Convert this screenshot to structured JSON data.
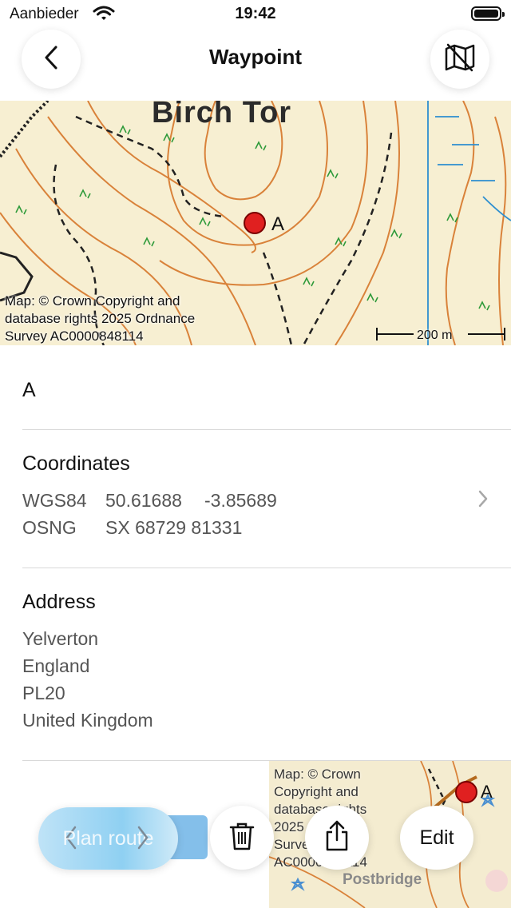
{
  "status_bar": {
    "carrier": "Aanbieder",
    "time": "19:42"
  },
  "nav": {
    "title": "Waypoint",
    "back_icon": "chevron-left-icon",
    "map_toggle_icon": "map-off-icon"
  },
  "map": {
    "place_label": "Birch Tor",
    "marker_label": "A",
    "credit": [
      "Map: © Crown Copyright and",
      "database rights 2025 Ordnance",
      "Survey AC0000848114"
    ],
    "scale": "200 m",
    "marker_color": "#e02020"
  },
  "waypoint": {
    "name": "A"
  },
  "coordinates": {
    "title": "Coordinates",
    "rows": [
      {
        "system": "WGS84",
        "value1": "50.61688",
        "value2": "-3.85689"
      },
      {
        "system": "OSNG",
        "value1": "SX 68729 81331",
        "value2": ""
      }
    ]
  },
  "address": {
    "title": "Address",
    "lines": [
      "Yelverton",
      "England",
      "PL20",
      "United Kingdom"
    ]
  },
  "mini_map": {
    "credit": [
      "Map: © Crown",
      "Copyright and",
      "database rights",
      "2025 Ordnance",
      "Survey",
      "AC0000848114"
    ],
    "place_label": "Postbridge",
    "marker_label": "A"
  },
  "toolbar": {
    "plan_route_label": "Plan route",
    "edit_label": "Edit",
    "delete_icon": "trash-icon",
    "share_icon": "share-icon"
  }
}
